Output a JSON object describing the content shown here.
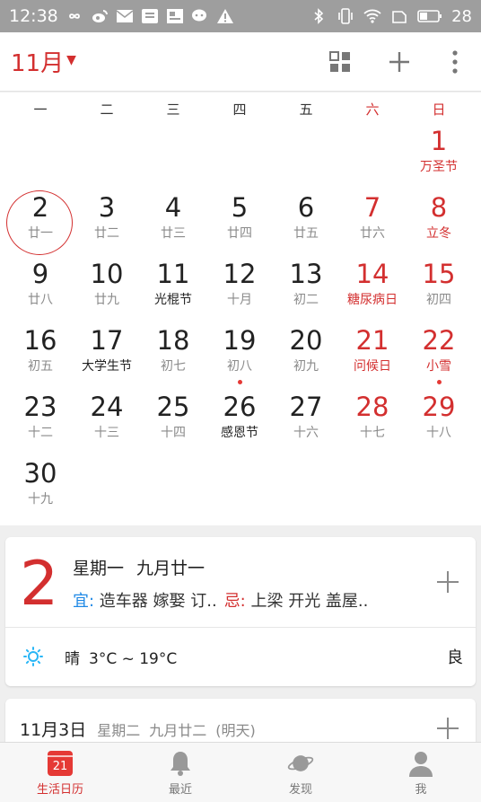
{
  "status_bar": {
    "time": "12:38",
    "battery": "28"
  },
  "header": {
    "month": "11月"
  },
  "weekdays": [
    "一",
    "二",
    "三",
    "四",
    "五",
    "六",
    "日"
  ],
  "days": [
    {
      "d": "1",
      "l": "万圣节",
      "col": 6,
      "row": 0,
      "red": true
    },
    {
      "d": "2",
      "l": "廿一",
      "col": 0,
      "row": 1,
      "today": true
    },
    {
      "d": "3",
      "l": "廿二",
      "col": 1,
      "row": 1
    },
    {
      "d": "4",
      "l": "廿三",
      "col": 2,
      "row": 1
    },
    {
      "d": "5",
      "l": "廿四",
      "col": 3,
      "row": 1
    },
    {
      "d": "6",
      "l": "廿五",
      "col": 4,
      "row": 1
    },
    {
      "d": "7",
      "l": "廿六",
      "col": 5,
      "row": 1,
      "red": true,
      "lunar_gray": true
    },
    {
      "d": "8",
      "l": "立冬",
      "col": 6,
      "row": 1,
      "red": true
    },
    {
      "d": "9",
      "l": "廿八",
      "col": 0,
      "row": 2
    },
    {
      "d": "10",
      "l": "廿九",
      "col": 1,
      "row": 2
    },
    {
      "d": "11",
      "l": "光棍节",
      "col": 2,
      "row": 2,
      "festival": true
    },
    {
      "d": "12",
      "l": "十月",
      "col": 3,
      "row": 2
    },
    {
      "d": "13",
      "l": "初二",
      "col": 4,
      "row": 2
    },
    {
      "d": "14",
      "l": "糖尿病日",
      "col": 5,
      "row": 2,
      "red": true
    },
    {
      "d": "15",
      "l": "初四",
      "col": 6,
      "row": 2,
      "red": true,
      "lunar_gray": true
    },
    {
      "d": "16",
      "l": "初五",
      "col": 0,
      "row": 3
    },
    {
      "d": "17",
      "l": "大学生节",
      "col": 1,
      "row": 3,
      "festival": true
    },
    {
      "d": "18",
      "l": "初七",
      "col": 2,
      "row": 3
    },
    {
      "d": "19",
      "l": "初八",
      "col": 3,
      "row": 3,
      "dot": true
    },
    {
      "d": "20",
      "l": "初九",
      "col": 4,
      "row": 3
    },
    {
      "d": "21",
      "l": "问候日",
      "col": 5,
      "row": 3,
      "red": true
    },
    {
      "d": "22",
      "l": "小雪",
      "col": 6,
      "row": 3,
      "red": true,
      "dot": true
    },
    {
      "d": "23",
      "l": "十二",
      "col": 0,
      "row": 4
    },
    {
      "d": "24",
      "l": "十三",
      "col": 1,
      "row": 4
    },
    {
      "d": "25",
      "l": "十四",
      "col": 2,
      "row": 4
    },
    {
      "d": "26",
      "l": "感恩节",
      "col": 3,
      "row": 4,
      "festival": true
    },
    {
      "d": "27",
      "l": "十六",
      "col": 4,
      "row": 4
    },
    {
      "d": "28",
      "l": "十七",
      "col": 5,
      "row": 4,
      "red": true,
      "lunar_gray": true
    },
    {
      "d": "29",
      "l": "十八",
      "col": 6,
      "row": 4,
      "red": true,
      "lunar_gray": true
    },
    {
      "d": "30",
      "l": "十九",
      "col": 0,
      "row": 5
    }
  ],
  "selected_day": {
    "big_date": "2",
    "weekday": "星期一",
    "lunar": "九月廿一",
    "yi_label": "宜:",
    "yi_text": " 造车器 嫁娶 订..",
    "ji_label": "忌:",
    "ji_text": " 上梁 开光 盖屋.."
  },
  "weather": {
    "icon": "sun-icon",
    "condition": "晴",
    "temp": "3°C ~ 19°C",
    "air_quality": "良"
  },
  "next_day": {
    "date": "11月3日",
    "weekday": "星期二",
    "lunar": "九月廿二",
    "relative": "(明天)"
  },
  "bottom_nav": [
    {
      "label": "生活日历",
      "icon": "calendar-icon",
      "badge": "21",
      "active": true
    },
    {
      "label": "最近",
      "icon": "bell-icon"
    },
    {
      "label": "发现",
      "icon": "planet-icon"
    },
    {
      "label": "我",
      "icon": "person-icon"
    }
  ],
  "colors": {
    "accent": "#d32f2f",
    "yi": "#1e88e5"
  }
}
